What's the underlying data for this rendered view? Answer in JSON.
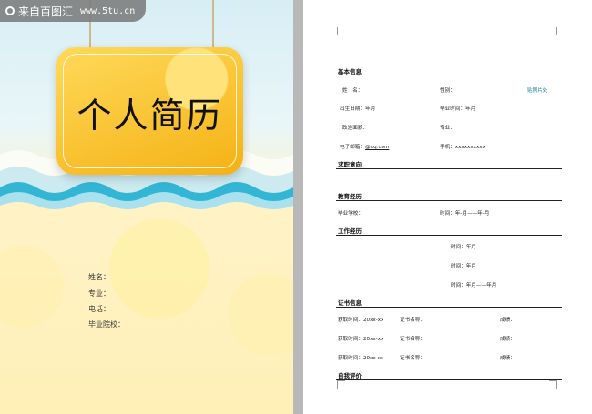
{
  "watermark": {
    "brand": "来自百图汇",
    "url": "www.5tu.cn"
  },
  "cover": {
    "title": "个人简历",
    "fields": [
      "姓名：",
      "专业：",
      "电话：",
      "毕业院校："
    ]
  },
  "resume": {
    "basic_info": {
      "title": "基本信息",
      "name_label": "姓　名：",
      "gender_label": "性别：",
      "photo_label": "贴照片处",
      "birth_label": "出生日期：年月",
      "grad_time_label": "毕业时间：年月",
      "education_label": "政治面貌：",
      "major_label": "专业：",
      "email_label": "电子邮箱：",
      "email_value": "@qq.com",
      "phone_label": "手机：",
      "phone_value": "xxxxxxxxxx"
    },
    "objective": {
      "title": "求职意向"
    },
    "education": {
      "title": "教育经历",
      "school_label": "毕业学校：",
      "time_label": "时间：年-月——年-月"
    },
    "work": {
      "title": "工作经历",
      "times": [
        "时间：年月",
        "时间：年月",
        "时间：年月——年月"
      ]
    },
    "certificates": {
      "title": "证书信息",
      "rows": [
        {
          "time": "获取时间：20xx-xx",
          "name": "证书名称：",
          "score": "成绩："
        },
        {
          "time": "获取时间：20xx-xx",
          "name": "证书名称：",
          "score": "成绩："
        },
        {
          "time": "获取时间：20xx-xx",
          "name": "证书名称：",
          "score": "成绩："
        }
      ]
    },
    "self_eval": {
      "title": "自我评价"
    }
  }
}
